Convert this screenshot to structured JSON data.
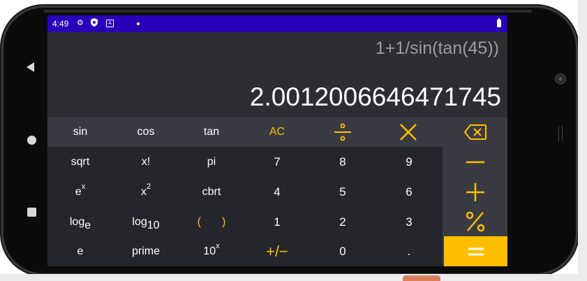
{
  "status_bar": {
    "time": "4:49"
  },
  "display": {
    "expression": "1+1/sin(tan(45))",
    "result": "2.0012006646471745"
  },
  "keys": {
    "sin": "sin",
    "cos": "cos",
    "tan": "tan",
    "ac": "AC",
    "sqrt": "sqrt",
    "factorial": "x!",
    "pi": "pi",
    "exp_base": "e",
    "exp_sup": "x",
    "square_base": "x",
    "square_sup": "2",
    "cbrt": "cbrt",
    "loge_base": "log",
    "loge_sub": "e",
    "log10_base": "log",
    "log10_sub": "10",
    "paren_open": "(",
    "paren_close": ")",
    "e": "e",
    "prime": "prime",
    "pow10_base": "10",
    "pow10_sup": "x",
    "plus_minus": "+/−",
    "d7": "7",
    "d8": "8",
    "d9": "9",
    "d4": "4",
    "d5": "5",
    "d6": "6",
    "d1": "1",
    "d2": "2",
    "d3": "3",
    "d0": "0",
    "dot": "."
  },
  "colors": {
    "accent": "#ffbf00",
    "status_bar": "#2a00b8",
    "display_bg": "#2d2e33",
    "function_row": "#3a3b42",
    "number_pad": "#25262b"
  },
  "icons": [
    "divide-icon",
    "multiply-icon",
    "backspace-icon",
    "minus-icon",
    "plus-icon",
    "percent-icon",
    "equals-icon",
    "back-icon",
    "home-icon",
    "recents-icon"
  ]
}
